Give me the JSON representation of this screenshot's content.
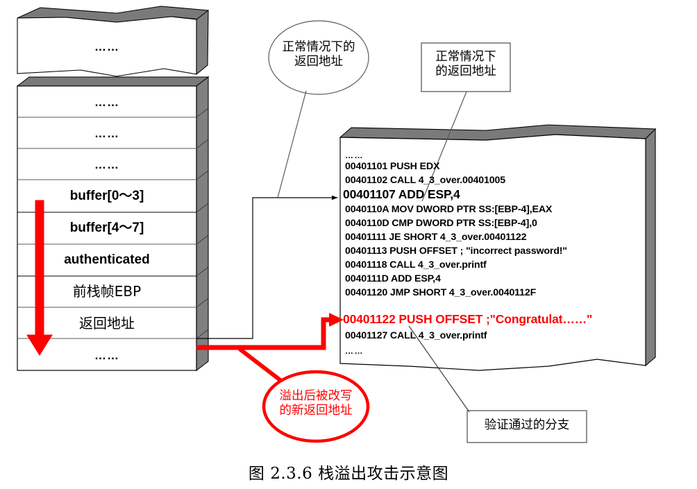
{
  "caption": "图 2.3.6    栈溢出攻击示意图",
  "stack": {
    "torn_block_label": "……",
    "cells": [
      {
        "label": "……",
        "kind": "dots"
      },
      {
        "label": "……",
        "kind": "dots"
      },
      {
        "label": "……",
        "kind": "dots"
      },
      {
        "label": "buffer[0～3]",
        "kind": "latin"
      },
      {
        "label": "buffer[4～7]",
        "kind": "latin"
      },
      {
        "label": "authenticated",
        "kind": "latin"
      },
      {
        "label": "前栈帧EBP",
        "kind": "cjk"
      },
      {
        "label": "返回地址",
        "kind": "cjk"
      },
      {
        "label": "……",
        "kind": "dots"
      }
    ],
    "growth_arrow_name": "stack-growth-down-arrow",
    "growth_arrow_color": "#ff0000"
  },
  "code_block": {
    "lines": [
      {
        "text": "……",
        "style": "dots"
      },
      {
        "text": "00401101 PUSH EDX",
        "style": "normal"
      },
      {
        "text": "00401102 CALL 4_3_over.00401005",
        "style": "normal"
      },
      {
        "text": "00401107 ADD ESP,4",
        "style": "big"
      },
      {
        "text": "0040110A MOV DWORD PTR SS:[EBP-4],EAX",
        "style": "normal"
      },
      {
        "text": "0040110D CMP DWORD PTR SS:[EBP-4],0",
        "style": "normal"
      },
      {
        "text": "00401111 JE SHORT 4_3_over.00401122",
        "style": "normal"
      },
      {
        "text": "00401113 PUSH OFFSET ; \"incorrect password!\"",
        "style": "normal"
      },
      {
        "text": "00401118 CALL 4_3_over.printf",
        "style": "normal"
      },
      {
        "text": "0040111D ADD ESP,4",
        "style": "normal"
      },
      {
        "text": "00401120 JMP SHORT 4_3_over.0040112F",
        "style": "normal"
      },
      {
        "text": "00401122 PUSH OFFSET ;\"Congratulat……\"",
        "style": "highlight"
      },
      {
        "text": "00401127 CALL 4_3_over.printf",
        "style": "normal"
      },
      {
        "text": "……",
        "style": "dots"
      }
    ],
    "highlight_color": "#ff0000"
  },
  "callouts": {
    "normal_return_oval": "正常情况下的\n返回地址",
    "normal_return_box": "正常情况下\n的返回地址",
    "overwritten_return_oval": "溢出后被改写\n的新返回地址",
    "pass_branch_box": "验证通过的分支"
  },
  "colors": {
    "overflow_red": "#ff0000",
    "box_3d_gray": "#808080",
    "outline": "#000000",
    "cell_divider": "#666666"
  }
}
